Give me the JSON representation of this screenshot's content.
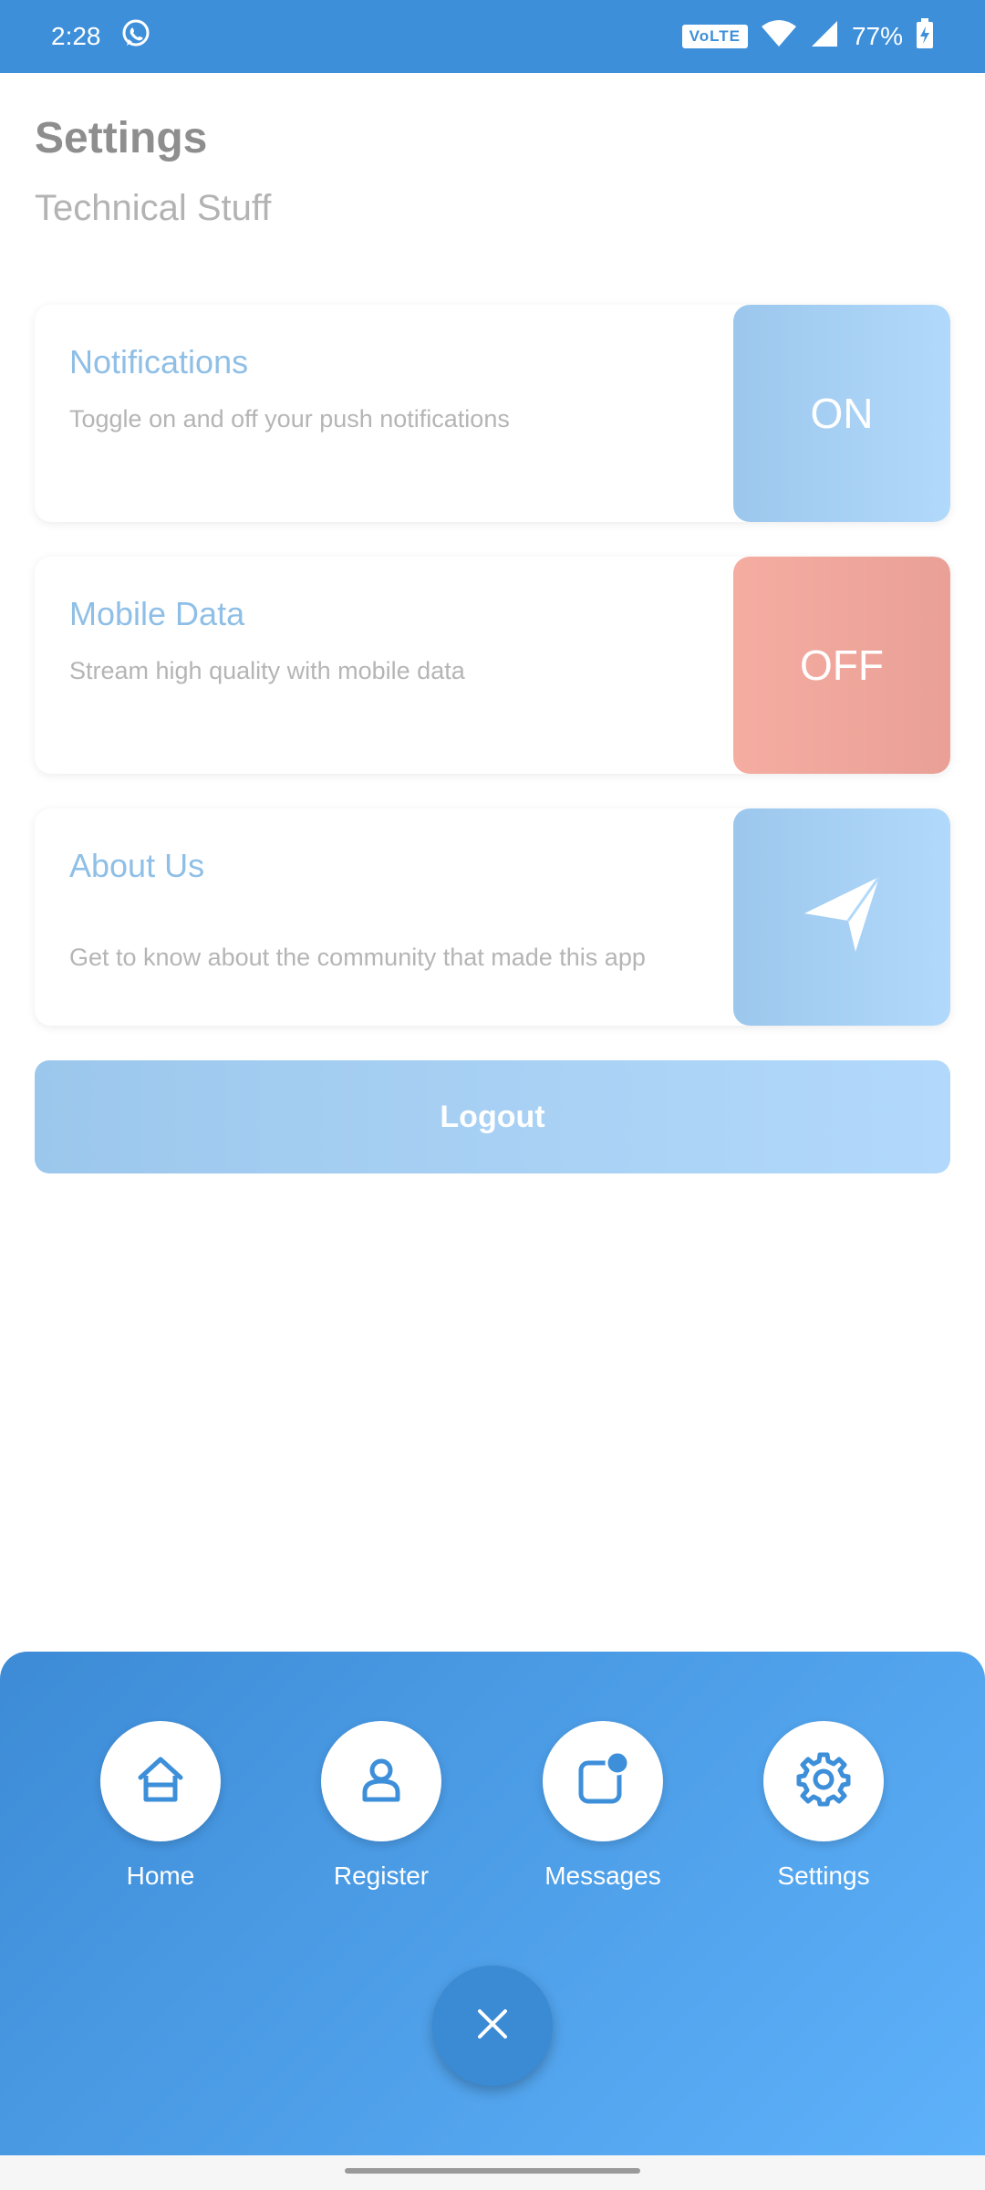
{
  "status_bar": {
    "time": "2:28",
    "network_badge": "VoLTE",
    "battery": "77%",
    "icons": [
      "whatsapp-icon",
      "wifi-icon",
      "signal-icon",
      "battery-charging-icon"
    ]
  },
  "header": {
    "title": "Settings",
    "subtitle": "Technical Stuff"
  },
  "cards": [
    {
      "title": "Notifications",
      "description": "Toggle on and off your push notifications",
      "action": "ON",
      "color": "#9cc7ec"
    },
    {
      "title": "Mobile Data",
      "description": "Stream high quality with mobile data",
      "action": "OFF",
      "color": "#f5aca1"
    },
    {
      "title": "About Us",
      "description": "Get to know about the community that made this app",
      "action_icon": "send-icon",
      "color": "#9cc7ec"
    }
  ],
  "logout_label": "Logout",
  "nav": {
    "items": [
      {
        "label": "Home",
        "icon": "home-icon"
      },
      {
        "label": "Register",
        "icon": "user-icon"
      },
      {
        "label": "Messages",
        "icon": "message-icon"
      },
      {
        "label": "Settings",
        "icon": "gear-icon"
      }
    ],
    "close_icon": "close-icon"
  },
  "colors": {
    "primary": "#3d8fd9",
    "accent_light": "#b1d9fb",
    "off_red": "#f5aca1",
    "title_gray": "#8e8e8e"
  }
}
